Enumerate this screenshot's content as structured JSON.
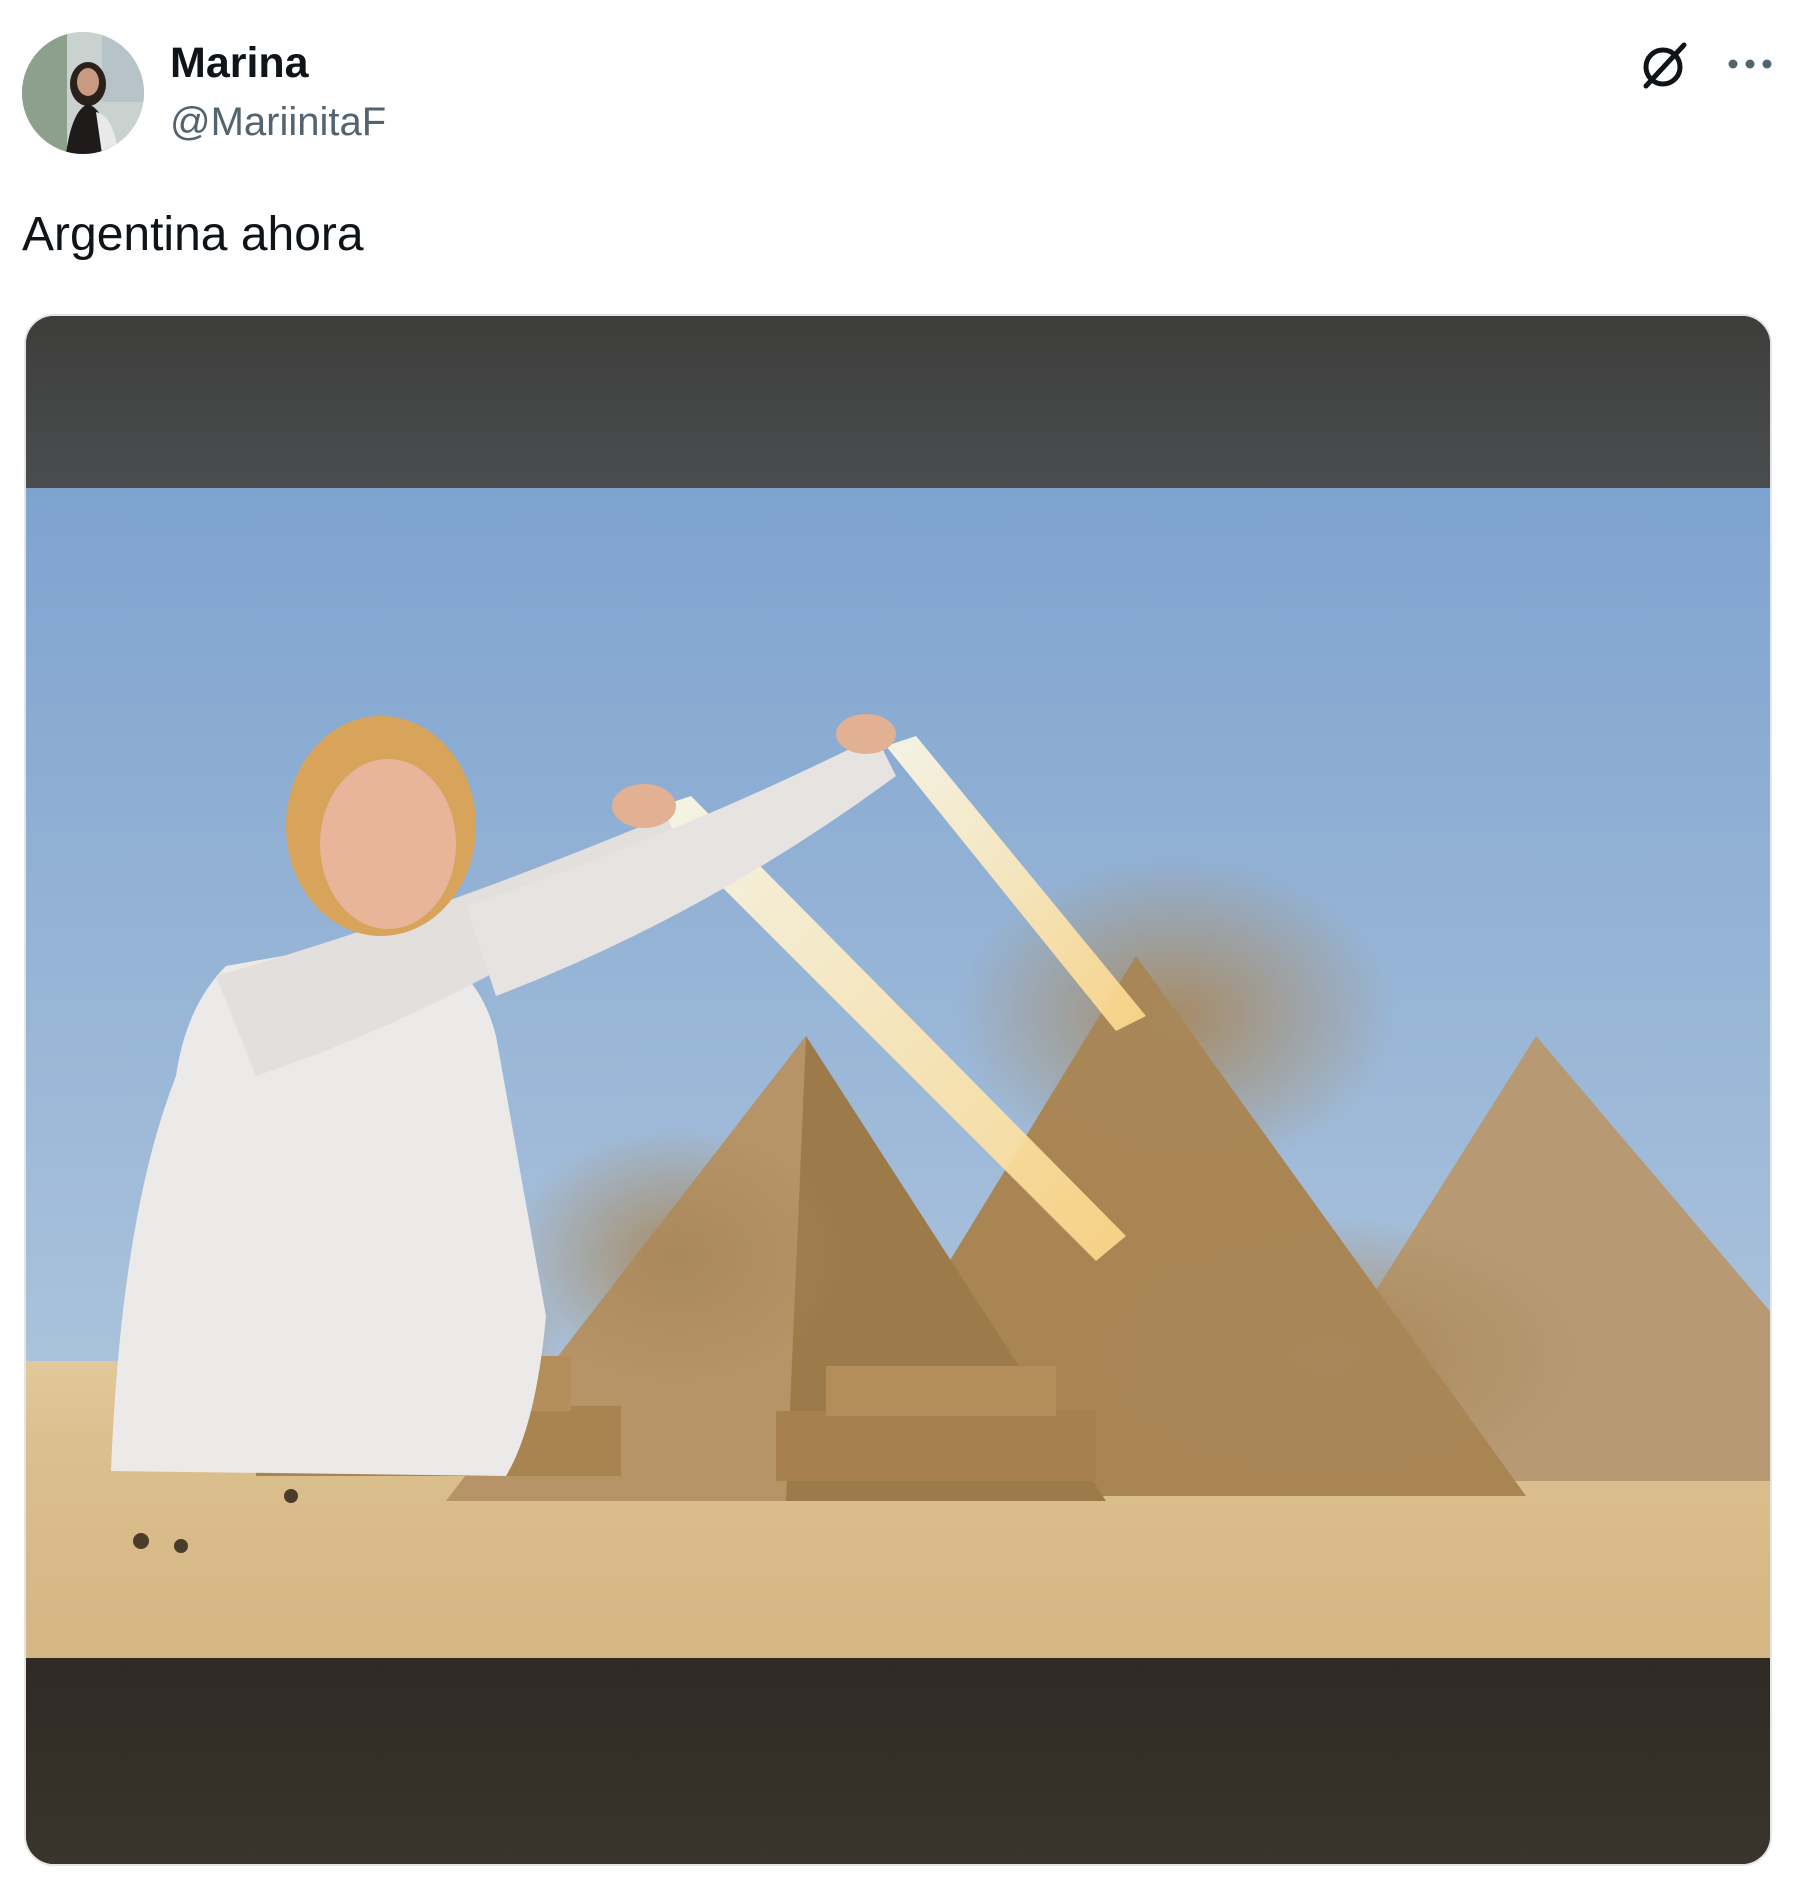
{
  "tweet": {
    "author": {
      "display_name": "Marina",
      "handle": "@MariinitaF"
    },
    "text": "Argentina ahora",
    "media": {
      "type": "image"
    }
  },
  "icons": {
    "grok": "grok-icon",
    "more": "more-icon"
  },
  "colors": {
    "text_primary": "#0f1419",
    "text_secondary": "#536471",
    "background": "#ffffff"
  }
}
